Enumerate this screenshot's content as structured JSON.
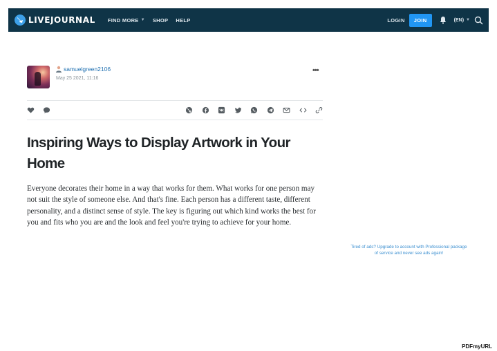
{
  "header": {
    "logo_text": "LIVEJOURNAL",
    "nav": [
      {
        "label": "FIND MORE",
        "has_caret": true
      },
      {
        "label": "SHOP",
        "has_caret": false
      },
      {
        "label": "HELP",
        "has_caret": false
      }
    ],
    "login_label": "LOGIN",
    "join_label": "JOIN",
    "language": "(EN)"
  },
  "post": {
    "username": "samuelgreen2106",
    "date": "May 25 2021, 11:16",
    "more_label": "•••",
    "title": "Inspiring Ways to Display Artwork in Your Home",
    "body": "Everyone decorates their home in a way that works for them. What works for one person may not suit the style of someone else. And that's fine. Each person has a different taste, different personality, and a distinct sense of style. The key is figuring out which kind works the best for you and fits who you are and the look and feel you're trying to achieve for your home."
  },
  "actions": {
    "left": [
      "heart-icon",
      "comment-icon"
    ],
    "share": [
      "livejournal-share-icon",
      "facebook-icon",
      "vk-icon",
      "twitter-icon",
      "whatsapp-icon",
      "telegram-icon",
      "email-icon",
      "embed-icon",
      "link-icon"
    ]
  },
  "sidebar": {
    "ad_note": "Tired of ads? Upgrade to account with Professional package of service and never see ads again!"
  },
  "watermark": {
    "text": "PDFmyURL"
  },
  "colors": {
    "header_bg": "#0f3447",
    "join_bg": "#2196f3",
    "link": "#1e6fb0"
  }
}
